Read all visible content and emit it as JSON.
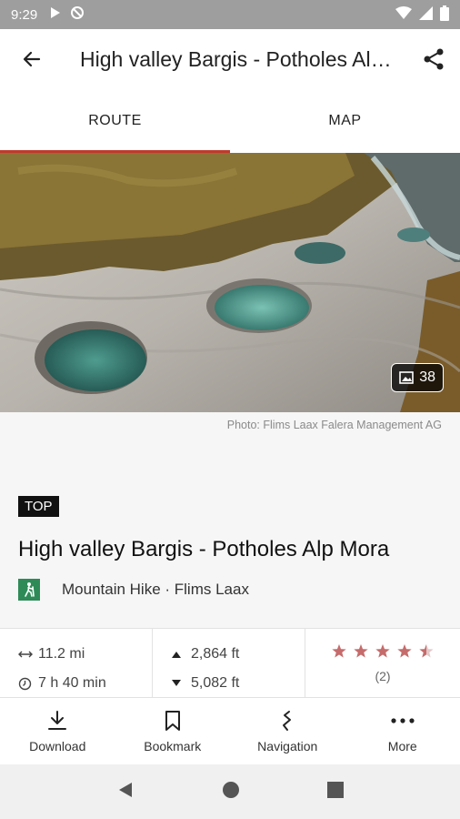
{
  "status_bar": {
    "time": "9:29"
  },
  "app_bar": {
    "title": "High valley Bargis - Potholes Alp Mora"
  },
  "tabs": [
    {
      "label": "ROUTE"
    },
    {
      "label": "MAP"
    }
  ],
  "hero": {
    "photo_count": "38",
    "credit": "Photo: Flims Laax Falera Management AG"
  },
  "tour": {
    "badge": "TOP",
    "title": "High valley Bargis - Potholes Alp Mora",
    "category": "Mountain Hike · Flims Laax"
  },
  "stats": {
    "distance": "11.2 mi",
    "duration": "7 h 40 min",
    "ascent": "2,864 ft",
    "descent": "5,082 ft",
    "rating": 4.5,
    "rating_count": "(2)"
  },
  "actions": [
    {
      "label": "Download",
      "icon": "download-icon"
    },
    {
      "label": "Bookmark",
      "icon": "bookmark-icon"
    },
    {
      "label": "Navigation",
      "icon": "navigation-icon"
    },
    {
      "label": "More",
      "icon": "more-icon"
    }
  ],
  "colors": {
    "accent": "#c0392b",
    "star": "#c66b6b",
    "category": "#2e8b57"
  }
}
